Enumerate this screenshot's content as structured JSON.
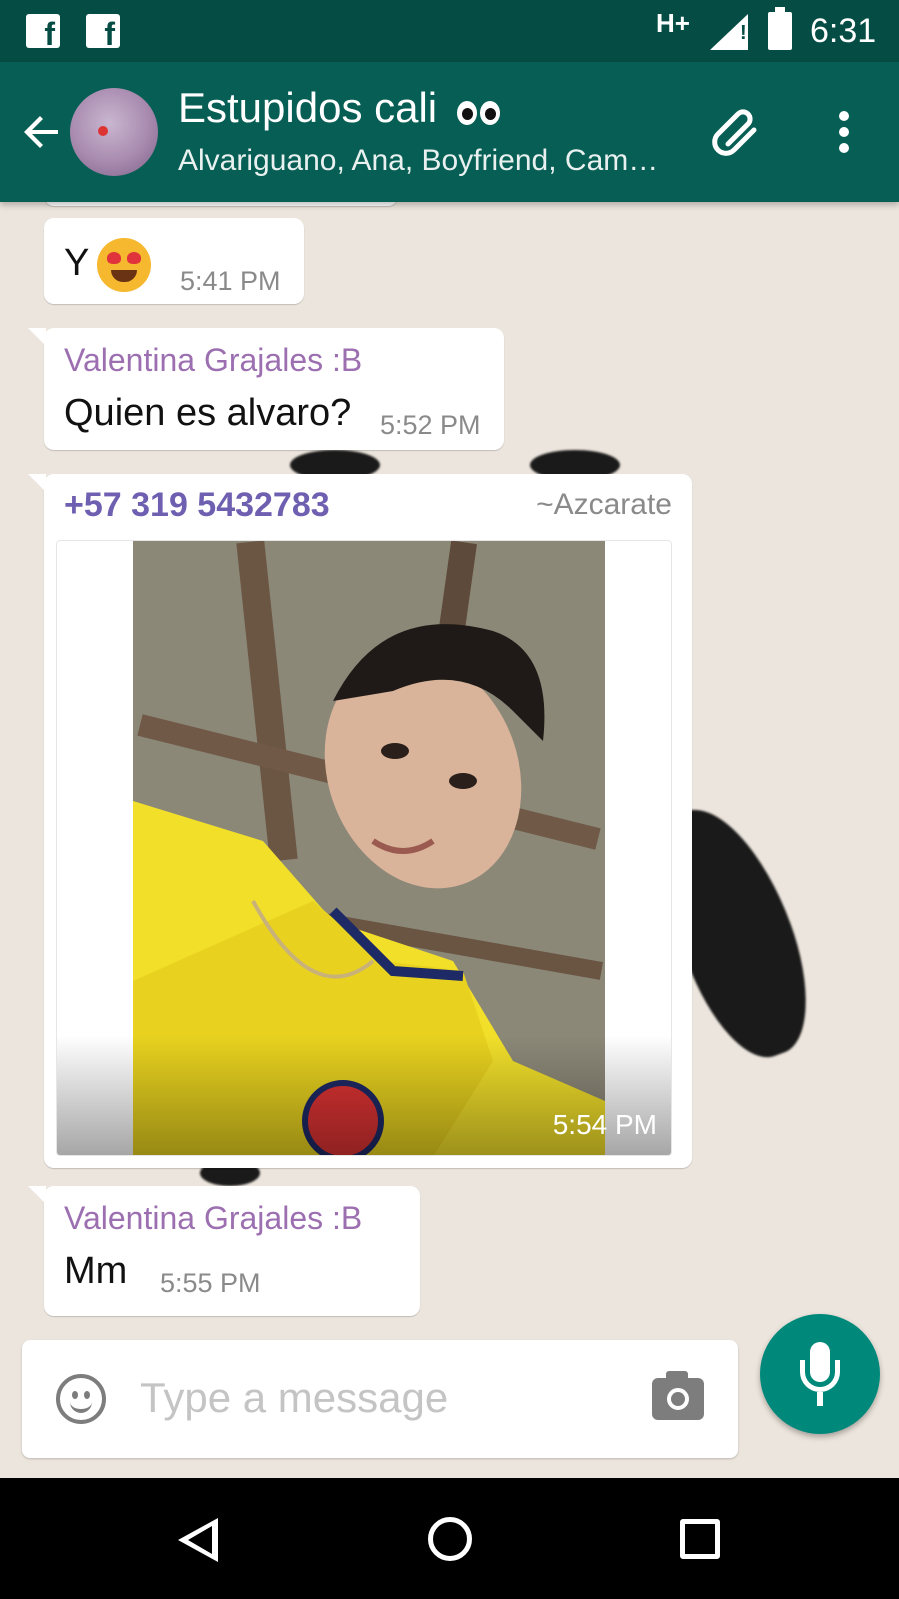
{
  "status_bar": {
    "network": "H+",
    "time": "6:31",
    "notification_icons": [
      "facebook-icon",
      "facebook-icon"
    ]
  },
  "header": {
    "title": "Estupidos cali",
    "title_emoji": "eyes",
    "subtitle": "Alvariguano, Ana, Boyfriend, Cam…",
    "accent_color": "#075e54"
  },
  "messages": [
    {
      "type": "text",
      "text": "Y",
      "emoji": "heart-eyes",
      "time": "5:41 PM"
    },
    {
      "type": "text",
      "sender": "Valentina Grajales :B",
      "text": "Quien es alvaro?",
      "time": "5:52 PM"
    },
    {
      "type": "image",
      "sender_phone": "+57 319 5432783",
      "sender_alias": "~Azcarate",
      "time": "5:54 PM"
    },
    {
      "type": "text",
      "sender": "Valentina Grajales :B",
      "text": "Mm",
      "time": "5:55 PM"
    }
  ],
  "input": {
    "placeholder": "Type a message"
  },
  "colors": {
    "fab": "#00897b",
    "sender_name": "#9c6fb1",
    "phone_sender": "#6e5fb0"
  }
}
